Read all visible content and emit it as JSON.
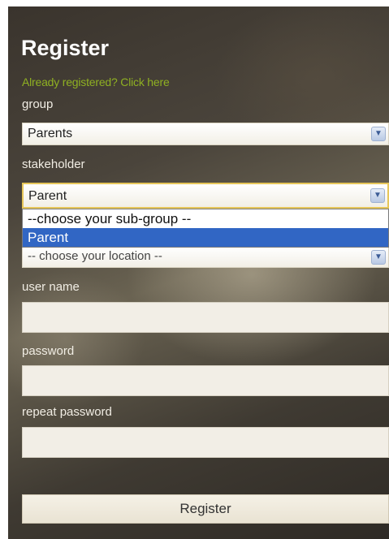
{
  "form": {
    "title": "Register",
    "login_link": "Already registered? Click here",
    "group": {
      "label": "group",
      "selected": "Parents"
    },
    "stakeholder": {
      "label": "stakeholder",
      "selected": "Parent",
      "options": [
        "--choose your sub-group --",
        "Parent"
      ],
      "highlighted_option": "Parent"
    },
    "location": {
      "selected": "-- choose your location --"
    },
    "username": {
      "label": "user name",
      "value": ""
    },
    "password": {
      "label": "password",
      "value": ""
    },
    "repeat_password": {
      "label": "repeat password",
      "value": ""
    },
    "submit_label": "Register"
  },
  "colors": {
    "link": "#8fb022",
    "highlight": "#3166c4",
    "focus_border": "#e6c65a"
  },
  "icons": {
    "dropdown": "chevron-down-icon"
  }
}
